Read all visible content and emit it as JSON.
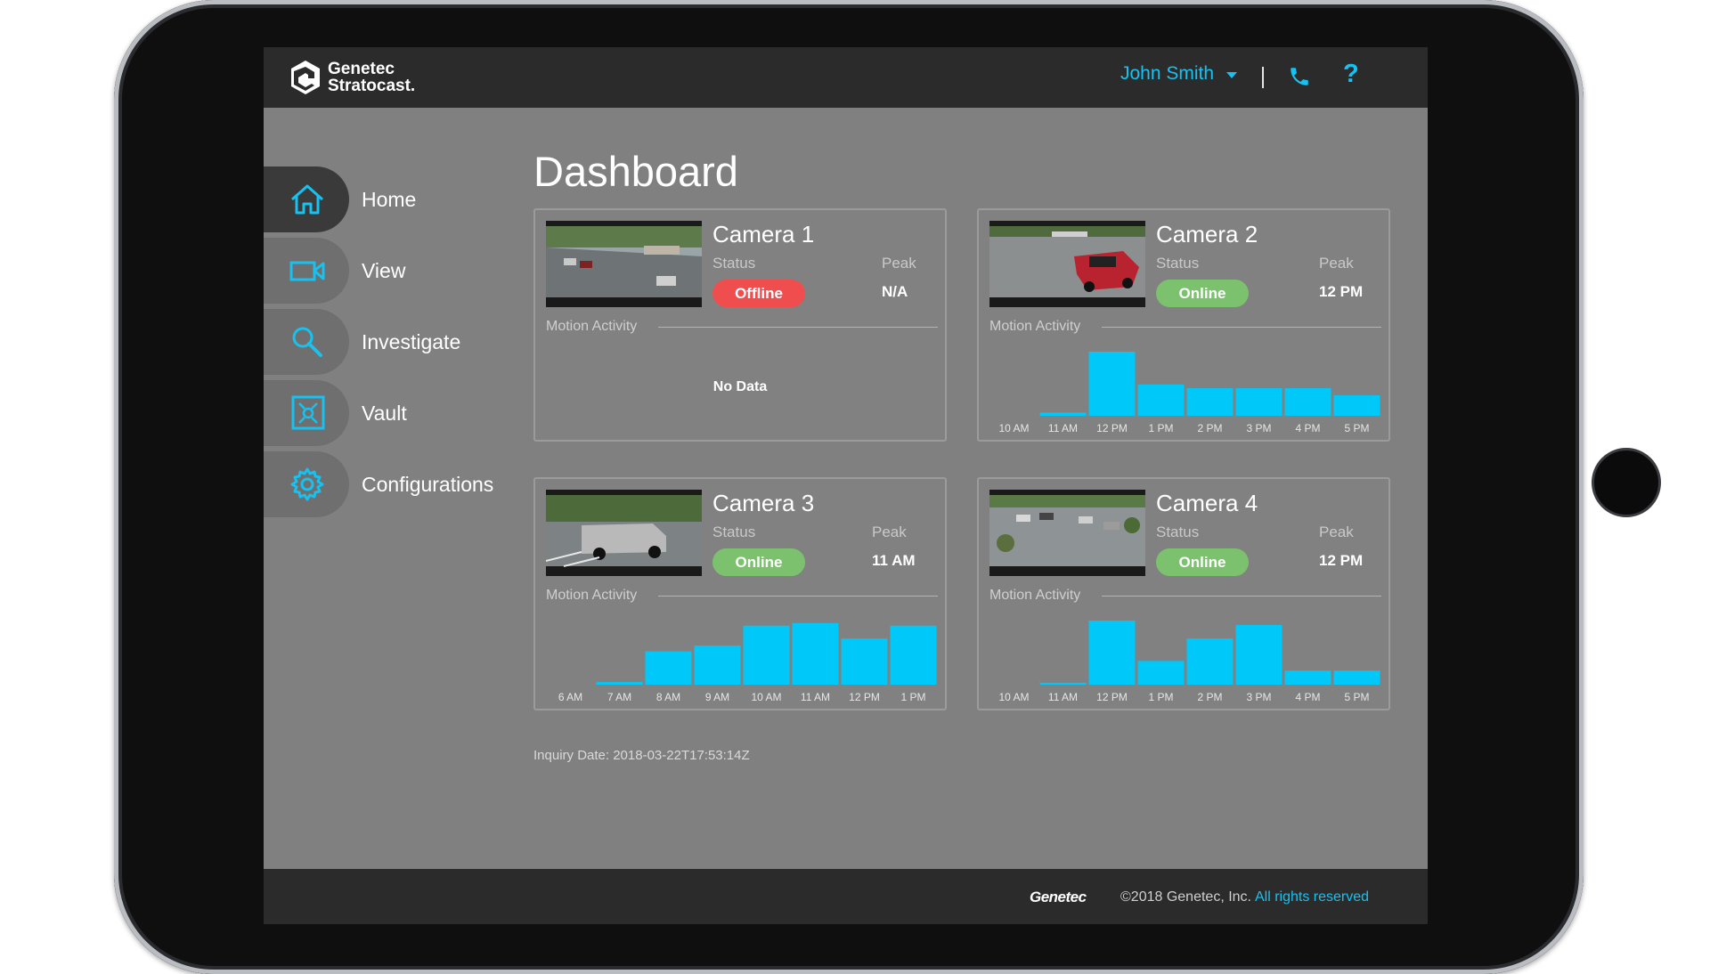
{
  "header": {
    "brand_line1": "Genetec",
    "brand_line2": "Stratocast.",
    "user_name": "John Smith"
  },
  "nav": {
    "items": [
      {
        "label": "Home",
        "icon": "home-icon",
        "active": true
      },
      {
        "label": "View",
        "icon": "video-camera-icon",
        "active": false
      },
      {
        "label": "Investigate",
        "icon": "search-icon",
        "active": false
      },
      {
        "label": "Vault",
        "icon": "vault-icon",
        "active": false
      },
      {
        "label": "Configurations",
        "icon": "gear-icon",
        "active": false
      }
    ]
  },
  "page": {
    "title": "Dashboard",
    "inquiry_date": "Inquiry Date: 2018-03-22T17:53:14Z"
  },
  "labels": {
    "status": "Status",
    "peak": "Peak",
    "motion_activity": "Motion Activity",
    "no_data": "No Data"
  },
  "cameras": [
    {
      "name": "Camera 1",
      "status": "Offline",
      "peak": "N/A",
      "chart": null
    },
    {
      "name": "Camera 2",
      "status": "Online",
      "peak": "12 PM",
      "chart": {
        "categories": [
          "10 AM",
          "11 AM",
          "12 PM",
          "1 PM",
          "2 PM",
          "3 PM",
          "4 PM",
          "5 PM"
        ],
        "values": [
          0,
          5,
          100,
          49,
          43,
          43,
          43,
          32
        ]
      }
    },
    {
      "name": "Camera 3",
      "status": "Online",
      "peak": "11 AM",
      "chart": {
        "categories": [
          "6 AM",
          "7 AM",
          "8 AM",
          "9 AM",
          "10 AM",
          "11 AM",
          "12 PM",
          "1 PM"
        ],
        "values": [
          0,
          4,
          52,
          61,
          92,
          96,
          72,
          92
        ]
      }
    },
    {
      "name": "Camera 4",
      "status": "Online",
      "peak": "12 PM",
      "chart": {
        "categories": [
          "10 AM",
          "11 AM",
          "12 PM",
          "1 PM",
          "2 PM",
          "3 PM",
          "4 PM",
          "5 PM"
        ],
        "values": [
          0,
          3,
          100,
          37,
          72,
          93,
          22,
          22
        ]
      }
    }
  ],
  "footer": {
    "brand": "Genetec",
    "copyright": "©2018 Genetec, Inc.",
    "rights": "All rights reserved"
  },
  "colors": {
    "accent": "#17c1f0",
    "bar": "#00c8f8",
    "online": "#7cc26e",
    "offline": "#f04e4e"
  }
}
